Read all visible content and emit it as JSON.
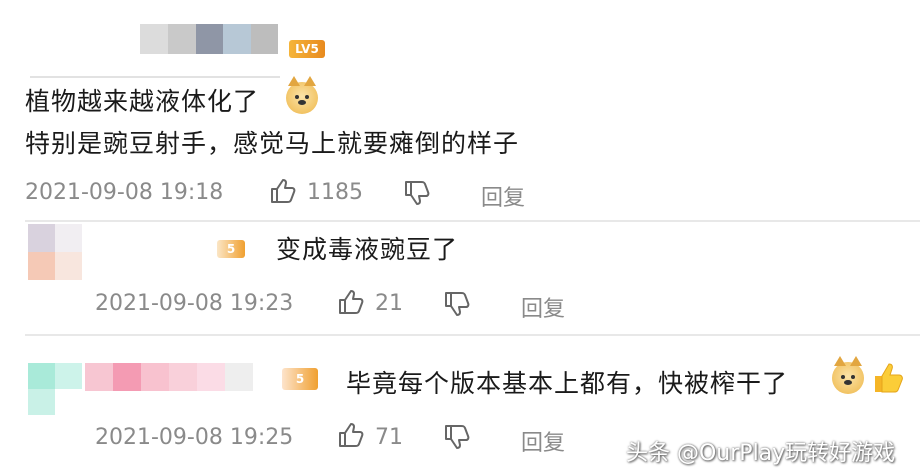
{
  "comments": [
    {
      "badge": "LV5",
      "lines": [
        "植物越来越液体化了",
        "特别是豌豆射手，感觉马上就要瘫倒的样子"
      ],
      "time": "2021-09-08 19:18",
      "likes": "1185",
      "reply_label": "回复"
    },
    {
      "badge": "5",
      "lines": [
        "变成毒液豌豆了"
      ],
      "time": "2021-09-08 19:23",
      "likes": "21",
      "reply_label": "回复"
    },
    {
      "badge": "5",
      "lines": [
        "毕竟每个版本基本上都有，快被榨干了"
      ],
      "time": "2021-09-08 19:25",
      "likes": "71",
      "reply_label": "回复"
    }
  ],
  "watermark": "头条 @OurPlay玩转好游戏",
  "icons": {
    "like": "thumbs-up-icon",
    "dislike": "thumbs-down-icon",
    "doge": "doge-emoji-icon",
    "thumbs_emoji": "thumbs-up-emoji-icon"
  },
  "colors": {
    "text": "#1a1a1a",
    "meta": "#8a8a8a",
    "badge": "#f0a030",
    "divider": "#e8e8e8"
  }
}
